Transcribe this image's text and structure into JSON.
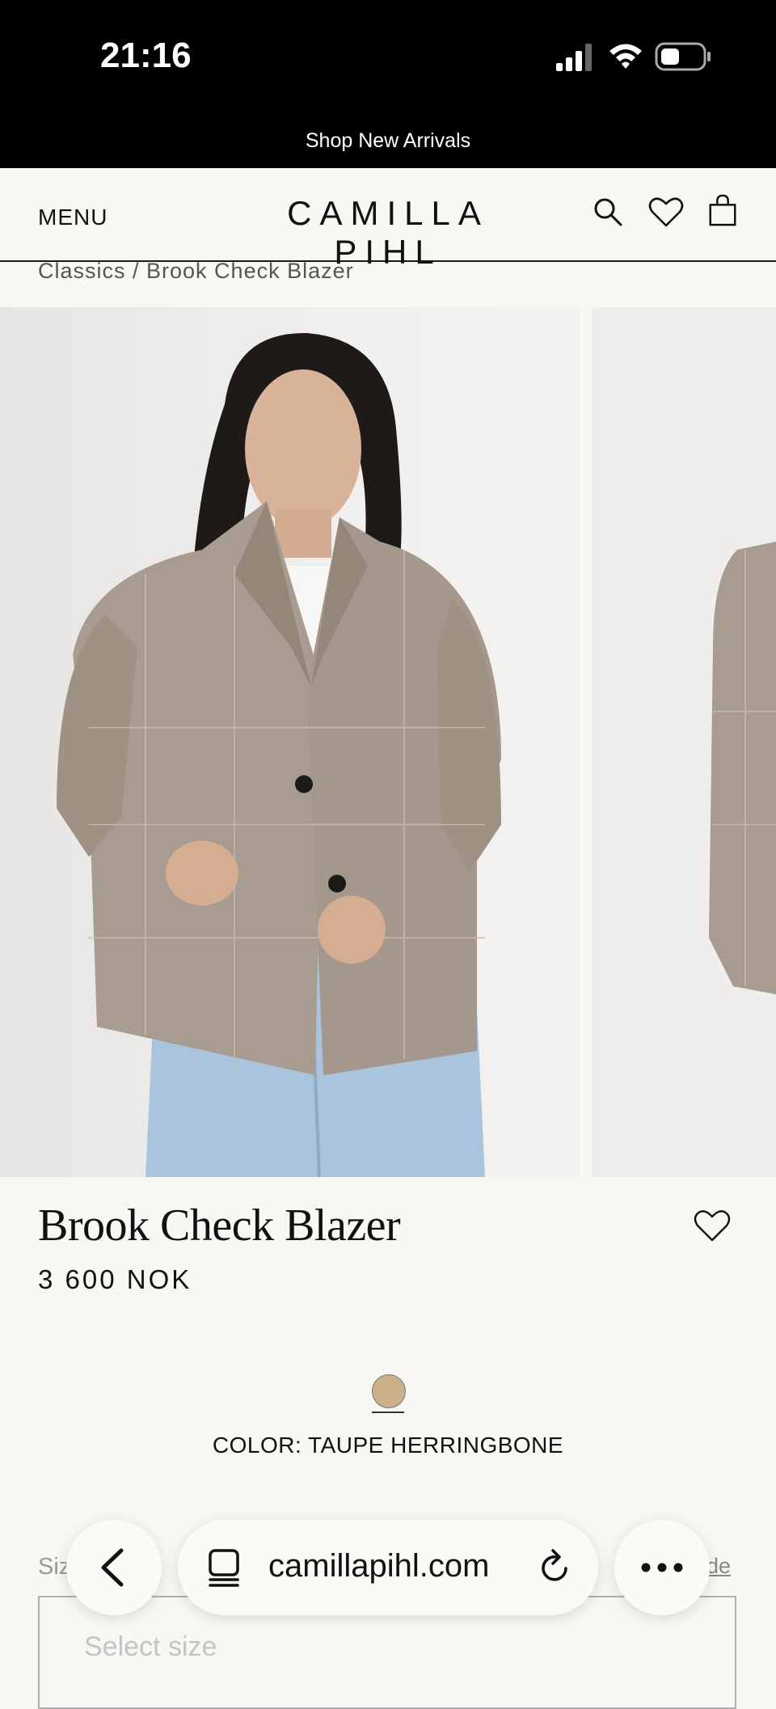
{
  "status_bar": {
    "time": "21:16"
  },
  "promo": {
    "text": "Shop New Arrivals"
  },
  "header": {
    "menu_label": "MENU",
    "brand": "CAMILLA PIHL"
  },
  "breadcrumb": "Classics / Brook Check Blazer",
  "product": {
    "title": "Brook Check Blazer",
    "price": "3 600 NOK",
    "color_label": "COLOR: TAUPE HERRINGBONE",
    "swatch_color": "#cbb08a"
  },
  "size": {
    "label": "Siz",
    "guide_link": "ide",
    "placeholder": "Select size"
  },
  "browser": {
    "url": "camillapihl.com"
  },
  "colors": {
    "background": "#f8f7f3",
    "status_bar": "#000000",
    "text": "#111111"
  }
}
